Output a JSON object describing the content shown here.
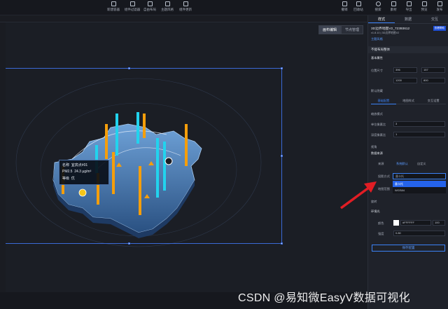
{
  "toolbar": {
    "tools": [
      "新建容器",
      "组件过滤器",
      "自由布局",
      "主题风格",
      "组件更新"
    ],
    "right_tools": [
      "撤销",
      "回收站",
      "搜索",
      "素材",
      "导出",
      "预览",
      "发布"
    ]
  },
  "canvas": {
    "mode_tabs": [
      "画布编辑",
      "节点管理"
    ]
  },
  "tooltip": {
    "name_label": "名称",
    "name_value": "宜宾点#01",
    "pm_label": "PM2.5",
    "pm_value": "24.3",
    "pm_unit": "μg/m³",
    "level_label": "等级",
    "level_value": "优"
  },
  "panel": {
    "tabs": [
      "样式",
      "数据",
      "交互"
    ],
    "title": "3D边界地图V2_72393612",
    "version": "v1.8.10 | 3D边界地图V2",
    "badge": "查看帮助",
    "theme_link": "主题风格",
    "section_style": "不能布局整体",
    "basic_attr": "基本属性",
    "pos_label": "位置尺寸",
    "pos_x": "396",
    "pos_y": "157",
    "pos_w": "1200",
    "pos_h": "800",
    "hide_label": "默认隐藏",
    "subtabs": [
      "基础配置",
      "地图样式",
      "交互设置"
    ],
    "scale_label": "缩放模式",
    "unit_x_label": "单位像素比",
    "unit_x": "3",
    "unit_y_label": "深度像素比",
    "unit_y": "1",
    "view_label": "视角",
    "source_label": "数据来源",
    "src_label": "来源",
    "src_opt1": "系统默认",
    "src_opt2": "自定义",
    "proj_label": "投影方式",
    "proj_placeholder": "墨卡托",
    "opt_selected": "墨卡托",
    "opt_other": "WGS84",
    "range_label": "地图范围",
    "rotate_label": "旋转",
    "env_label": "环境光",
    "color_label": "颜色",
    "color_value": "#FFFFFF",
    "color_pct": "100",
    "intensity_label": "强度",
    "intensity_value": "0.80",
    "save_btn": "保存配置"
  },
  "watermark": "CSDN @易知微EasyV数据可视化",
  "colors": {
    "accent": "#3b82f6",
    "map_fill": "#4a7fb8",
    "bar_cyan": "#22d3ee",
    "bar_orange": "#f59e0b",
    "arrow": "#e11d24"
  }
}
